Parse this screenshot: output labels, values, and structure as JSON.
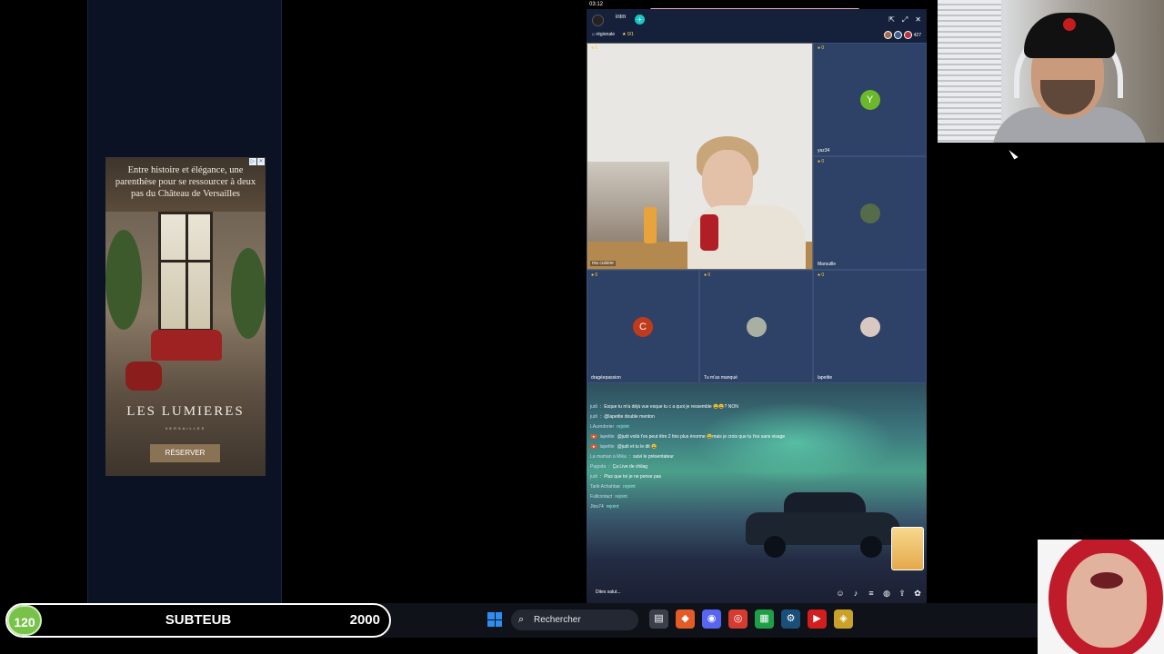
{
  "phone": {
    "time": "03:12"
  },
  "ad": {
    "text": "Entre histoire et élégance, une parenthèse pour se ressourcer à deux pas du Château de Versailles",
    "brand": "LES LUMIERES",
    "brand_sub": "VERSAILLES",
    "cta": "RÉSERVER"
  },
  "live": {
    "host_name": "intm",
    "tag_region": "régionale",
    "tag_score": "0/1",
    "viewer_count": "427",
    "main_label": "ma cuisine",
    "cells": [
      {
        "label": "yaz34",
        "avatar": "Y",
        "color": "#6bb82b"
      },
      {
        "label": "Marsuille",
        "avatar": "",
        "color": "#566b4a"
      },
      {
        "label": "dragéepassion",
        "avatar": "C",
        "color": "#c23a1c"
      },
      {
        "label": "Tu m'as manqué",
        "avatar": "",
        "color": "#a8b0a3"
      },
      {
        "label": "lapetite",
        "avatar": "",
        "color": "#d9c8c2"
      }
    ],
    "chat": [
      {
        "user": "judi",
        "text": "Esque tu m'a déjà vue esque tu c a quoi je ressemble 😀😀? NON"
      },
      {
        "user": "judi",
        "text": "@lapetite double menton"
      },
      {
        "user": "LAurndorier",
        "text": "rejoint"
      },
      {
        "user": "lapetite",
        "text": "@judi voilà t'es peut être 2 fois plus énorme 😀mais je crois que tu t'es sans visage"
      },
      {
        "user": "lapetite",
        "text": "@judi et tu le dit 😀"
      },
      {
        "user": "La maman à Mika",
        "text": "suivi le présentateur"
      },
      {
        "user": "Pagoda",
        "text": "Ça Live de chilag"
      },
      {
        "user": "judi",
        "text": "Plus que toi je ne pense pas"
      },
      {
        "user": "Tarik Achahbar",
        "text": "rejoint"
      },
      {
        "user": "Fullcontact",
        "text": "rejoint"
      },
      {
        "user": "Jlou74",
        "text": "rejoint"
      }
    ],
    "chat_placeholder": "Dites salut..."
  },
  "subgoal": {
    "count": "120",
    "title": "SUBTEUB",
    "goal": "2000"
  },
  "taskbar": {
    "search_label": "Rechercher",
    "apps": [
      "file-explorer-icon",
      "brave-icon",
      "discord-icon",
      "chrome-icon",
      "spreadsheet-icon",
      "steam-icon",
      "youtube-icon",
      "app-icon"
    ]
  }
}
